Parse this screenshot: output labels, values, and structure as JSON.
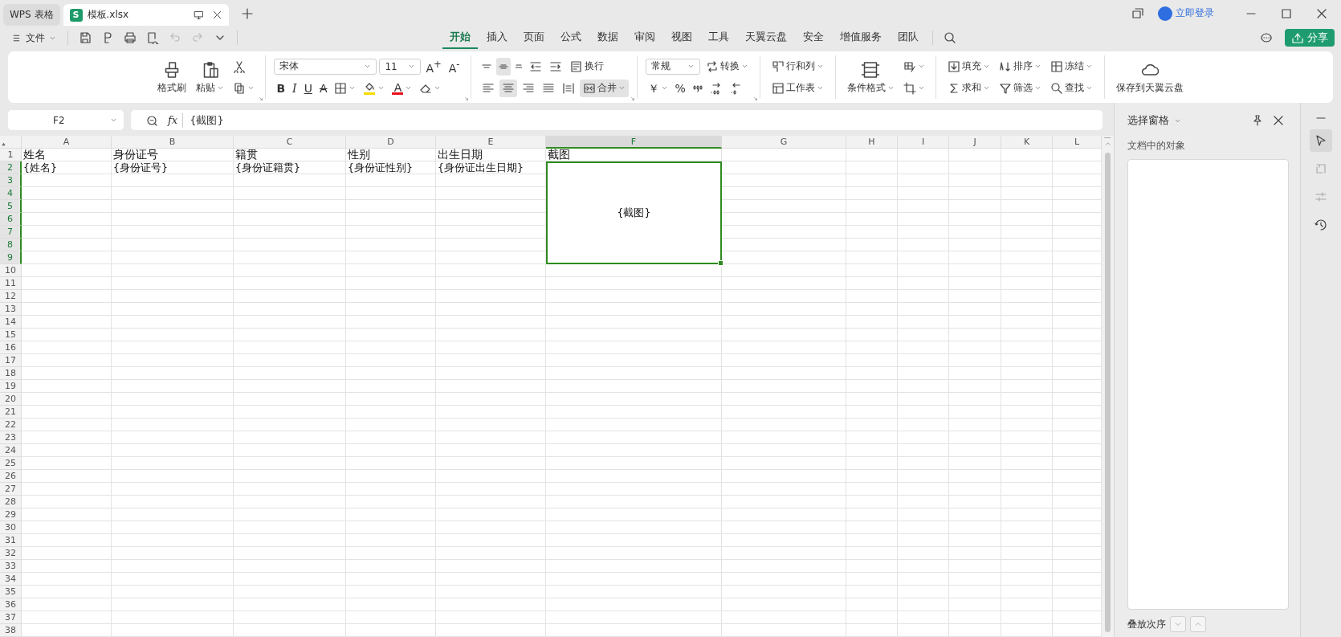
{
  "tabs": [
    {
      "label": "WPS 表格",
      "selected": false
    },
    {
      "label": "模板.xlsx",
      "selected": true,
      "logo": "S"
    }
  ],
  "account": {
    "label": "立即登录"
  },
  "file_menu": {
    "label": "文件"
  },
  "ribbon_tabs": [
    {
      "label": "开始",
      "selected": true
    },
    {
      "label": "插入",
      "selected": false
    },
    {
      "label": "页面",
      "selected": false
    },
    {
      "label": "公式",
      "selected": false
    },
    {
      "label": "数据",
      "selected": false
    },
    {
      "label": "审阅",
      "selected": false
    },
    {
      "label": "视图",
      "selected": false
    },
    {
      "label": "工具",
      "selected": false
    },
    {
      "label": "天翼云盘",
      "selected": false
    },
    {
      "label": "安全",
      "selected": false
    },
    {
      "label": "增值服务",
      "selected": false
    },
    {
      "label": "团队",
      "selected": false
    }
  ],
  "share_button": {
    "label": "分享"
  },
  "ribbon": {
    "groups": [
      {
        "launcher": true,
        "big": [
          {
            "label": "格式刷",
            "dropdown": false
          },
          {
            "label": "粘贴",
            "dropdown": true
          }
        ],
        "top": [
          {
            "kind": "tool",
            "dropdown": false
          }
        ],
        "bottom": [
          {
            "kind": "tool",
            "dropdown": true
          }
        ]
      },
      {
        "launcher": true,
        "top": [
          {
            "kind": "select",
            "value": "宋体"
          },
          {
            "kind": "select",
            "value": "11"
          },
          {
            "kind": "glyph",
            "glyph": "A$^{+}$",
            "dropdown": false
          },
          {
            "kind": "glyph",
            "glyph": "A$^{-}$",
            "dropdown": false
          }
        ],
        "bottom": [
          {
            "kind": "glyph",
            "glyph": "B",
            "dropdown": false
          },
          {
            "kind": "glyph",
            "glyph": "I",
            "dropdown": false
          },
          {
            "kind": "glyph",
            "glyph": "U",
            "dropdown": false
          },
          {
            "kind": "glyph",
            "glyph": "A",
            "dropdown": false
          },
          {
            "kind": "tool",
            "dropdown": true
          },
          {
            "kind": "tool",
            "dropdown": true,
            "color": "#f7d900"
          },
          {
            "kind": "glyph",
            "glyph": "A",
            "dropdown": true,
            "color": "#e8101a"
          },
          {
            "kind": "tool",
            "dropdown": true
          }
        ]
      },
      {
        "launcher": true,
        "top": [
          {
            "kind": "tool",
            "dropdown": false,
            "selected": false
          },
          {
            "kind": "tool",
            "dropdown": false,
            "selected": true
          },
          {
            "kind": "tool",
            "dropdown": false,
            "selected": false
          },
          {
            "kind": "tool",
            "dropdown": false,
            "selected": false
          },
          {
            "kind": "tool",
            "dropdown": false,
            "selected": false
          },
          {
            "kind": "tool",
            "label": "换行",
            "dropdown": false,
            "selected": false
          }
        ],
        "bottom": [
          {
            "kind": "tool",
            "dropdown": false,
            "selected": false
          },
          {
            "kind": "tool",
            "dropdown": false,
            "selected": true
          },
          {
            "kind": "tool",
            "dropdown": false,
            "selected": false
          },
          {
            "kind": "tool",
            "dropdown": false,
            "selected": false
          },
          {
            "kind": "tool",
            "dropdown": false,
            "selected": false
          },
          {
            "kind": "tool",
            "label": "合并",
            "dropdown": true,
            "selected": true
          }
        ]
      },
      {
        "launcher": true,
        "top": [
          {
            "kind": "select",
            "value": "常规"
          },
          {
            "kind": "tool",
            "label": "转换",
            "dropdown": true
          }
        ],
        "bottom": [
          {
            "kind": "glyph",
            "glyph": "￥",
            "dropdown": true
          },
          {
            "kind": "glyph",
            "glyph": "%",
            "dropdown": false
          },
          {
            "kind": "tool",
            "dropdown": false
          },
          {
            "kind": "tool",
            "dropdown": false
          },
          {
            "kind": "tool",
            "dropdown": false
          }
        ]
      },
      {
        "launcher": false,
        "top": [
          {
            "kind": "tool",
            "label": "行和列",
            "dropdown": true
          }
        ],
        "bottom": [
          {
            "kind": "tool",
            "label": "工作表",
            "dropdown": true
          }
        ]
      },
      {
        "launcher": false,
        "big": [
          {
            "label": "条件格式",
            "dropdown": true
          }
        ],
        "top": [
          {
            "kind": "tool",
            "dropdown": true
          }
        ],
        "bottom": [
          {
            "kind": "tool",
            "dropdown": true
          }
        ]
      },
      {
        "launcher": false,
        "top": [
          {
            "kind": "tool",
            "label": "填充",
            "dropdown": true
          },
          {
            "kind": "tool",
            "label": "排序",
            "dropdown": true
          },
          {
            "kind": "tool",
            "label": "冻结",
            "dropdown": true
          }
        ],
        "bottom": [
          {
            "kind": "tool",
            "label": "求和",
            "dropdown": true
          },
          {
            "kind": "tool",
            "label": "筛选",
            "dropdown": true
          },
          {
            "kind": "tool",
            "label": "查找",
            "dropdown": true
          }
        ]
      },
      {
        "launcher": false,
        "big": [
          {
            "label": "保存到天翼云盘",
            "dropdown": false
          }
        ]
      }
    ]
  },
  "name_box": {
    "value": "F2"
  },
  "formula_bar": {
    "fx_label": "fx",
    "value": "{截图}"
  },
  "sheet": {
    "columns": [
      {
        "label": "A",
        "selected": false
      },
      {
        "label": "B",
        "selected": false
      },
      {
        "label": "C",
        "selected": false
      },
      {
        "label": "D",
        "selected": false
      },
      {
        "label": "E",
        "selected": false
      },
      {
        "label": "F",
        "selected": true
      },
      {
        "label": "G",
        "selected": false
      },
      {
        "label": "H",
        "selected": false
      },
      {
        "label": "I",
        "selected": false
      },
      {
        "label": "J",
        "selected": false
      },
      {
        "label": "K",
        "selected": false
      },
      {
        "label": "L",
        "selected": false
      }
    ],
    "rows": [
      {
        "label": "1",
        "selected": false,
        "cells": [
          "姓名",
          "身份证号",
          "籍贯",
          "性别",
          "出生日期",
          "截图"
        ]
      },
      {
        "label": "2",
        "selected": true,
        "cells": [
          "{姓名}",
          "{身份证号}",
          "{身份证籍贯}",
          "{身份证性别}",
          "{身份证出生日期}"
        ]
      },
      {
        "label": "3",
        "selected": true
      },
      {
        "label": "4",
        "selected": true
      },
      {
        "label": "5",
        "selected": true
      },
      {
        "label": "6",
        "selected": true
      },
      {
        "label": "7",
        "selected": true
      },
      {
        "label": "8",
        "selected": true
      },
      {
        "label": "9",
        "selected": true
      },
      {
        "label": "10",
        "selected": false
      },
      {
        "label": "11",
        "selected": false
      },
      {
        "label": "12",
        "selected": false
      },
      {
        "label": "13",
        "selected": false
      },
      {
        "label": "14",
        "selected": false
      },
      {
        "label": "15",
        "selected": false
      },
      {
        "label": "16",
        "selected": false
      },
      {
        "label": "17",
        "selected": false
      },
      {
        "label": "18",
        "selected": false
      },
      {
        "label": "19",
        "selected": false
      },
      {
        "label": "20",
        "selected": false
      },
      {
        "label": "21",
        "selected": false
      },
      {
        "label": "22",
        "selected": false
      },
      {
        "label": "23",
        "selected": false
      },
      {
        "label": "24",
        "selected": false
      },
      {
        "label": "25",
        "selected": false
      },
      {
        "label": "26",
        "selected": false
      },
      {
        "label": "27",
        "selected": false
      },
      {
        "label": "28",
        "selected": false
      },
      {
        "label": "29",
        "selected": false
      },
      {
        "label": "30",
        "selected": false
      },
      {
        "label": "31",
        "selected": false
      },
      {
        "label": "32",
        "selected": false
      },
      {
        "label": "33",
        "selected": false
      },
      {
        "label": "34",
        "selected": false
      },
      {
        "label": "35",
        "selected": false
      },
      {
        "label": "36",
        "selected": false
      },
      {
        "label": "37",
        "selected": false
      },
      {
        "label": "38",
        "selected": false
      }
    ],
    "merged_cell": {
      "text": "{截图}",
      "selected": true
    }
  },
  "side_panel": {
    "title": "选择窗格",
    "subtitle": "文档中的对象",
    "footer": "叠放次序"
  },
  "side_tools": [
    {
      "selected": true
    },
    {
      "selected": false
    },
    {
      "selected": false
    },
    {
      "selected": false
    }
  ]
}
